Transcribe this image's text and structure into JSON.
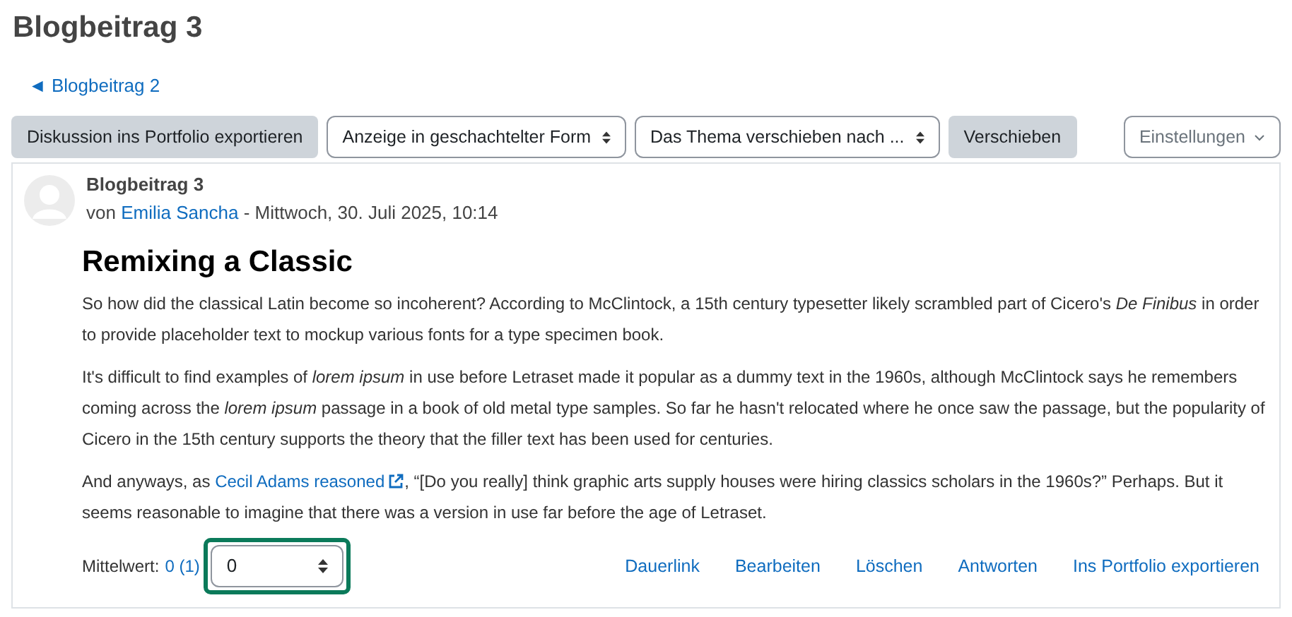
{
  "page_title": "Blogbeitrag 3",
  "back_link": "◄ Blogbeitrag 2",
  "toolbar": [
    {
      "kind": "button",
      "label": "Diskussion ins Portfolio exportieren"
    },
    {
      "kind": "select",
      "label": "Anzeige in geschachtelter Form"
    },
    {
      "kind": "select",
      "label": "Das Thema verschieben nach ..."
    },
    {
      "kind": "button",
      "label": "Verschieben"
    },
    {
      "kind": "menu",
      "label": "Einstellungen"
    }
  ],
  "post": {
    "subject": "Blogbeitrag 3",
    "by": "von",
    "author": "Emilia Sancha",
    "date": "- Mittwoch, 30. Juli 2025, 10:14",
    "heading": "Remixing a Classic",
    "paragraphs": [
      {
        "text": "So how did the classical Latin become so incoherent? According to McClintock, a 15th century typesetter likely scrambled part of Cicero's *De Finibus* in order to provide placeholder text to mockup various fonts for a type specimen book."
      },
      {
        "text": "It's difficult to find examples of *lorem ipsum* in use before Letraset made it popular as a dummy text in the 1960s, although McClintock says he remembers coming across the *lorem ipsum* passage in a book of old metal type samples. So far he hasn't relocated where he once saw the passage, but the popularity of Cicero in the 15th century supports the theory that the filler text has been used for centuries."
      },
      {
        "text": "And anyways, as",
        "link": "Cecil Adams reasoned",
        "after": ", “[Do you really] think graphic arts supply houses were hiring classics scholars in the 1960s?” Perhaps. But it seems reasonable to imagine that there was a version in use far before the age of Letraset."
      }
    ],
    "rating": {
      "label": "Mittelwert:",
      "value": "0 (1)",
      "select": "0",
      "focused": true
    },
    "actions": [
      "Dauerlink",
      "Bearbeiten",
      "Löschen",
      "Antworten",
      "Ins Portfolio exportieren"
    ]
  }
}
